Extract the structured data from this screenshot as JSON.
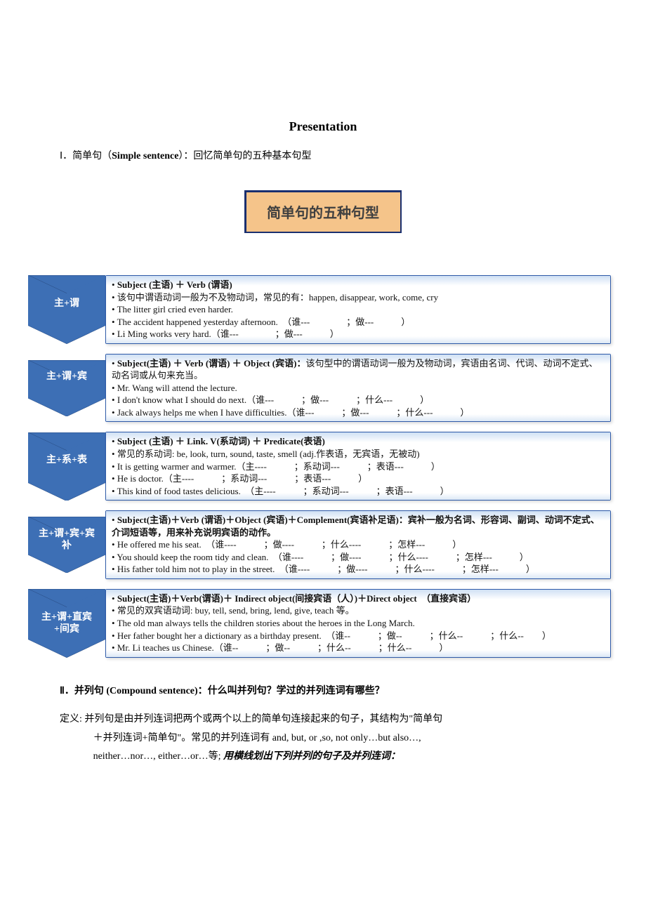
{
  "title": "Presentation",
  "section1": {
    "heading_prefix": "Ⅰ．简单句（",
    "heading_bold": "Simple sentence",
    "heading_suffix": "）：回忆简单句的五种基本句型",
    "banner": "简单句的五种句型"
  },
  "patterns": [
    {
      "label": "主+谓",
      "lines": [
        "<b>Subject (主语) ＋ Verb (谓语)</b>",
        "该句中谓语动词一般为不及物动词，常见的有：happen, disappear, work, come, cry",
        "The litter girl cried even harder.",
        "The accident happened yesterday afternoon.　（谁---　　　　；做---　　　）",
        "Li Ming works very hard.（谁---　　　　；做---　　　）"
      ]
    },
    {
      "label": "主+谓+宾",
      "lines": [
        "<b>Subject(主语) ＋ Verb (谓语) ＋ Object (宾语)：</b>该句型中的谓语动词一般为及物动词，宾语由名词、代词、动词不定式、动名词或从句来充当。",
        "Mr. Wang will attend the lecture.",
        "I don't know what I should do next.（谁---　　　；做---　　　；什么---　　　）",
        "Jack always helps me when I have difficulties.（谁---　　　；做---　　　；什么---　　　）"
      ]
    },
    {
      "label": "主+系+表",
      "lines": [
        "<b>Subject (主语) ＋ Link. V(系动词) ＋ Predicate(表语)</b>",
        "常见的系动词: be, look, turn, sound, taste, smell (adj.作表语，无宾语，无被动)",
        "It is getting warmer and warmer.（主----　　　；系动词---　　　；表语---　　　）",
        "He is doctor.（主----　　　；系动词---　　　；表语---　　　）",
        "This kind of food tastes delicious.　（主----　　　；系动词---　　　；表语---　　　）"
      ]
    },
    {
      "label": "主+谓+宾+宾补",
      "lines": [
        "<b>Subject(主语)＋Verb (谓语)＋Object (宾语)＋Complement(宾语补足语)：宾补一般为名词、形容词、副词、动词不定式、介词短语等，用来补充说明宾语的动作。</b>",
        "He offered me his seat.　（谁----　　　；做----　　　；什么----　　　；怎样---　　　）",
        "You should keep the room tidy and clean.　（谁----　　　；做----　　　；什么----　　　；怎样---　　　）",
        "His father told him not to play in the street.　（谁----　　　；做----　　　；什么----　　　；怎样---　　　）"
      ]
    },
    {
      "label": "主+谓+直宾+间宾",
      "lines": [
        "<b>Subject(主语)＋Verb(谓语)＋ Indirect object(间接宾语（人）)＋Direct object　（直接宾语）</b>",
        "常见的双宾语动词: buy, tell, send, bring, lend, give, teach 等。",
        "The old man always tells the children stories about the heroes in the Long March.",
        "Her father bought her a dictionary as a birthday present.　（谁--　　　；做--　　　；什么--　　　；什么--　　）",
        "Mr. Li teaches us Chinese.（谁--　　　；做--　　　；什么--　　　；什么--　　　）"
      ]
    }
  ],
  "section2": {
    "heading": "Ⅱ．并列句 (Compound sentence)：什么叫并列句？学过的并列连词有哪些？",
    "def_label": "定义: ",
    "def_body_1": "并列句是由并列连词把两个或两个以上的简单句连接起来的句子，其结构为\"简单句",
    "def_body_2": "＋并列连词+简单句\"。常见的并列连词有 and, but, or ,so, not only…but also…,",
    "def_body_3": "neither…nor…, either…or…等; ",
    "def_kaiti": "用横线划出下列并列的句子及并列连词："
  }
}
